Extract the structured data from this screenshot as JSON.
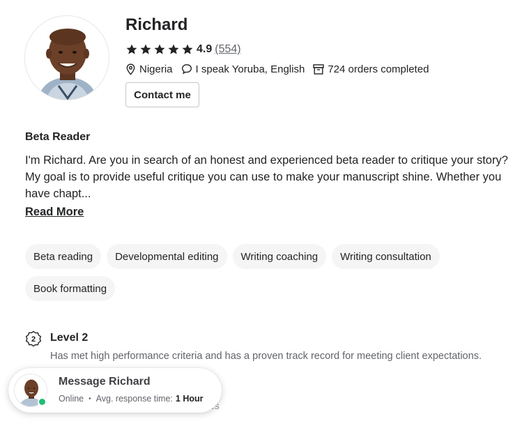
{
  "profile": {
    "name": "Richard",
    "rating": {
      "score": "4.9",
      "count": "(554)",
      "stars": 5
    },
    "location": "Nigeria",
    "languages": "I speak Yoruba, English",
    "orders": "724 orders completed",
    "contact_label": "Contact me"
  },
  "gig": {
    "title": "Beta Reader",
    "description": "I'm Richard. Are you in search of an honest and experienced beta reader to critique your story? My goal is to provide useful critique you can use to make your manuscript shine. Whether you have chapt...",
    "read_more": "Read More"
  },
  "tags": [
    "Beta reading",
    "Developmental editing",
    "Writing coaching",
    "Writing consultation",
    "Book formatting"
  ],
  "level": {
    "icon_text": "2",
    "title": "Level 2",
    "description": "Has met high performance criteria and has a proven track record for meeting client expectations."
  },
  "partial_text": "es",
  "message_card": {
    "title": "Message Richard",
    "status": "Online",
    "response_label": "Avg. response time:",
    "response_value": "1 Hour"
  },
  "colors": {
    "star": "#222325",
    "online": "#1dbf73",
    "tag_bg": "#f5f5f5",
    "muted": "#62646a"
  }
}
